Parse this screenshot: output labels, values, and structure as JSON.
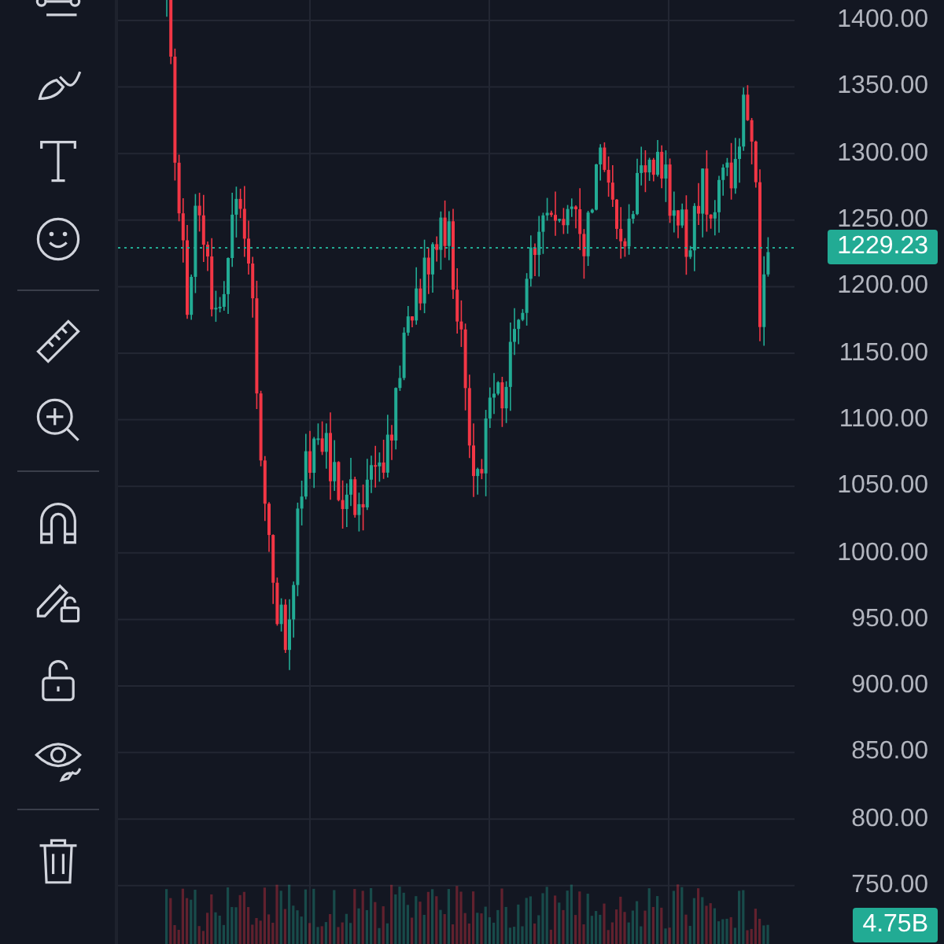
{
  "price_axis": {
    "ticks": [
      "1400.00",
      "1350.00",
      "1300.00",
      "1250.00",
      "1200.00",
      "1150.00",
      "1100.00",
      "1050.00",
      "1000.00",
      "950.00",
      "900.00",
      "850.00",
      "800.00",
      "750.00"
    ]
  },
  "current_price": {
    "label": "1229.23"
  },
  "volume": {
    "label": "4.75B"
  }
}
